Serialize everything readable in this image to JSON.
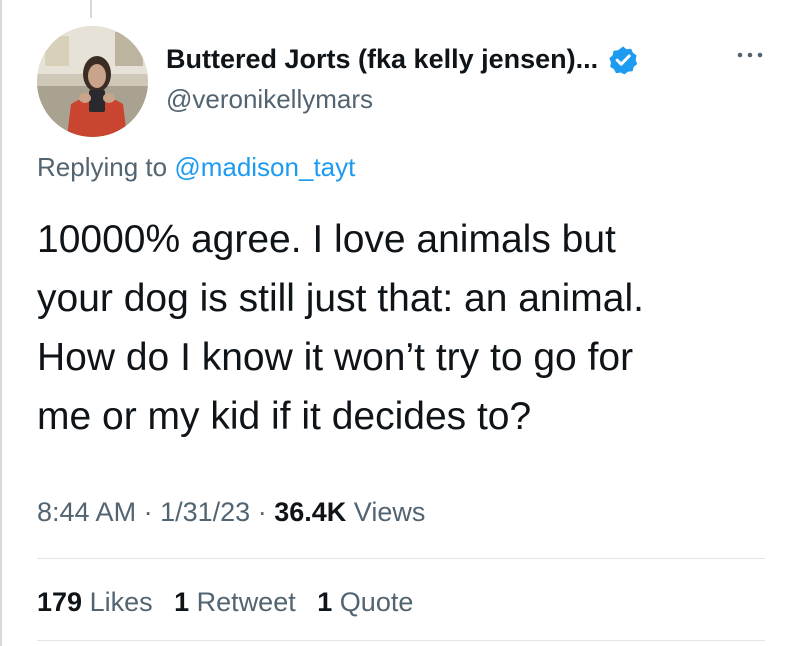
{
  "author": {
    "display_name": "Buttered Jorts (fka kelly jensen)...",
    "handle": "@veronikellymars",
    "verified": true
  },
  "reply": {
    "prefix": "Replying to",
    "handle": "@madison_tayt"
  },
  "tweet": {
    "lines": [
      "10000% agree. I love animals but",
      "your dog is still just that: an animal.",
      "How do I know it won’t try to go for",
      "me or my kid if it decides to?"
    ]
  },
  "meta": {
    "time": "8:44 AM",
    "separator": "·",
    "date": "1/31/23",
    "views_count": "36.4K",
    "views_label": "Views"
  },
  "stats": {
    "likes_count": "179",
    "likes_label": "Likes",
    "retweets_count": "1",
    "retweets_label": "Retweet",
    "quotes_count": "1",
    "quotes_label": "Quote"
  },
  "colors": {
    "accent": "#1d9bf0",
    "text": "#0f1419",
    "secondary": "#536471"
  },
  "icons": {
    "verified": "verified-badge-icon",
    "more": "more-options-icon"
  }
}
